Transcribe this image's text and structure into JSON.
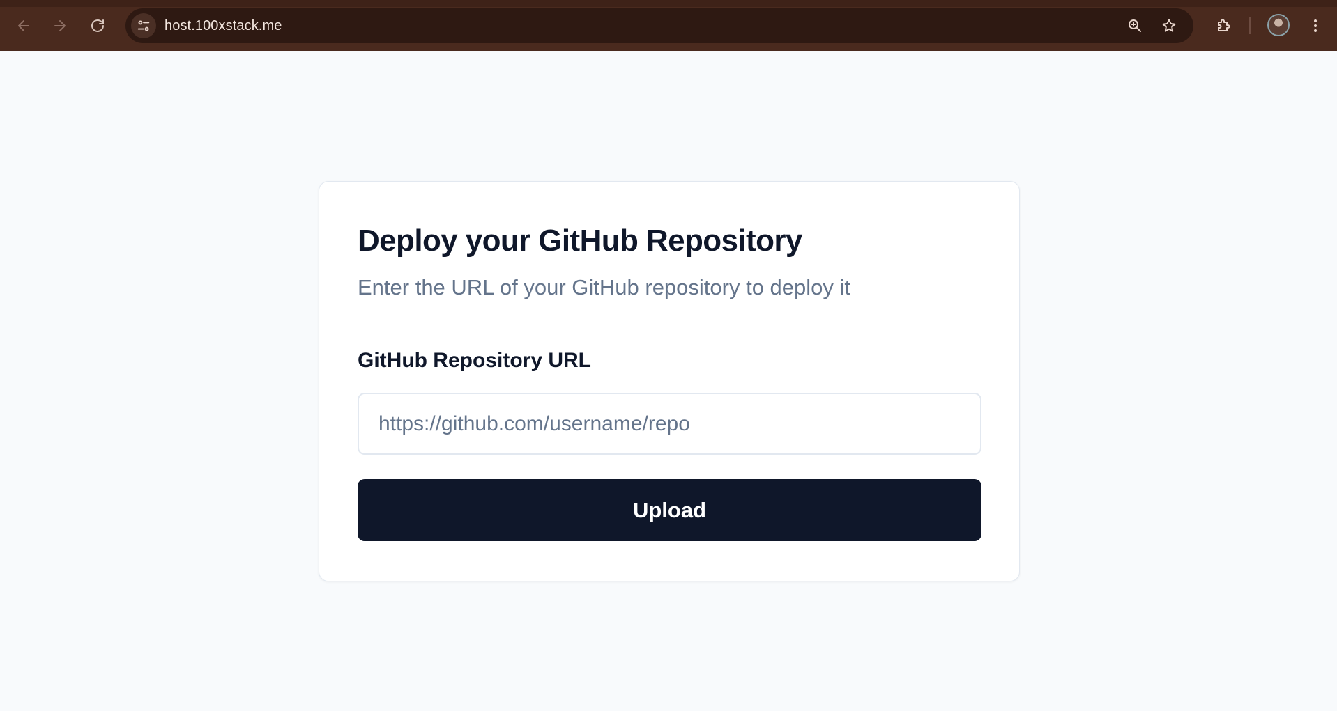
{
  "browser": {
    "url": "host.100xstack.me",
    "icons": {
      "back": "arrow-left-icon",
      "forward": "arrow-right-icon",
      "reload": "reload-icon",
      "site_info": "tune-icon",
      "zoom": "zoom-in-icon",
      "bookmark": "star-icon",
      "extensions": "puzzle-icon",
      "profile": "avatar",
      "menu": "kebab-menu-icon"
    },
    "colors": {
      "frame": "#4a2a1e",
      "omnibox": "#2e1912"
    }
  },
  "card": {
    "title": "Deploy your GitHub Repository",
    "description": "Enter the URL of your GitHub repository to deploy it",
    "field_label": "GitHub Repository URL",
    "input_value": "",
    "input_placeholder": "https://github.com/username/repo",
    "button_label": "Upload"
  },
  "colors": {
    "page_background": "#f8fafc",
    "card_background": "#ffffff",
    "primary_button": "#0f172a",
    "muted_text": "#64748b",
    "border": "#e2e8f0"
  }
}
